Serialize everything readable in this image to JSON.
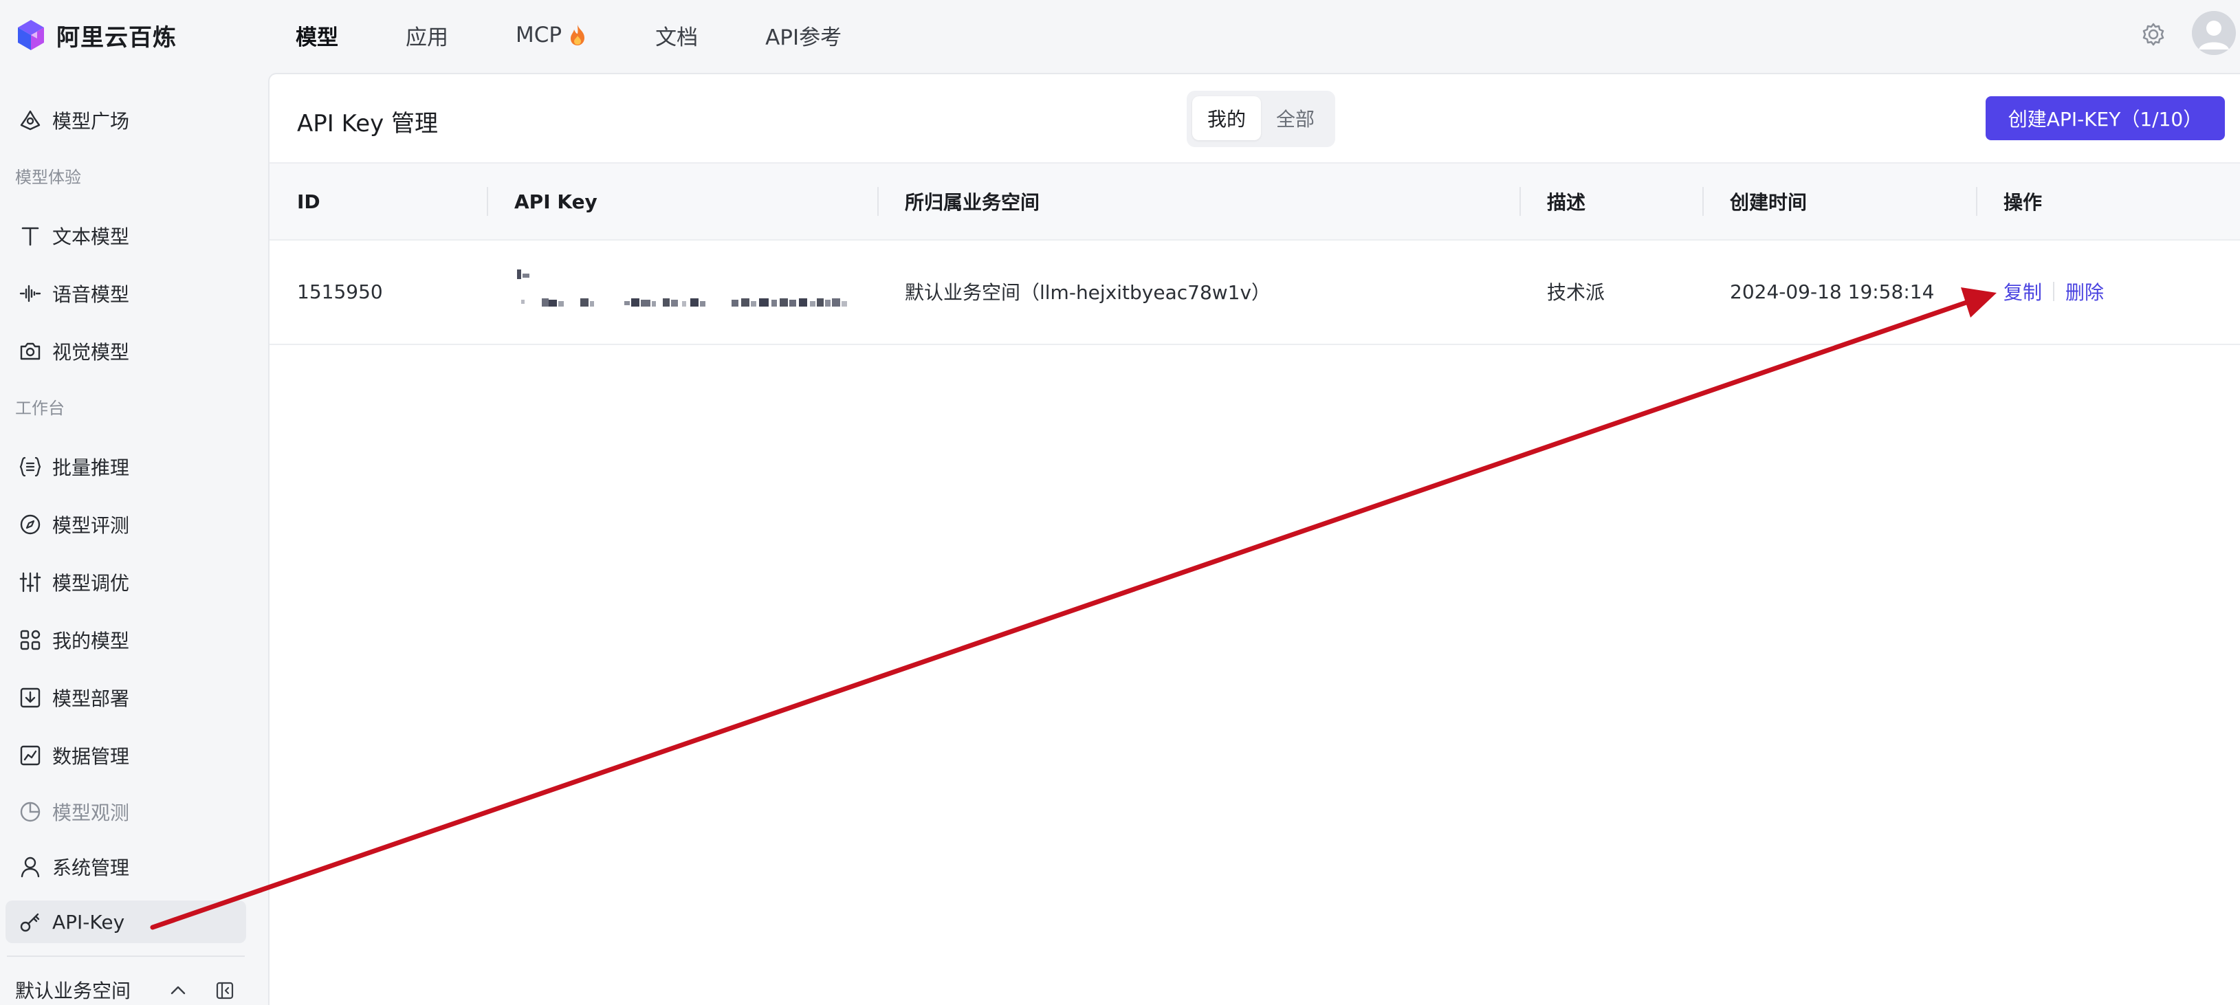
{
  "brand": {
    "name": "阿里云百炼"
  },
  "topnav": {
    "items": [
      {
        "label": "模型",
        "active": true
      },
      {
        "label": "应用",
        "active": false
      },
      {
        "label": "MCP",
        "active": false,
        "icon": "flame-icon"
      },
      {
        "label": "文档",
        "active": false
      },
      {
        "label": "API参考",
        "active": false
      }
    ],
    "settings_icon": "gear-icon",
    "avatar_icon": "user-avatar"
  },
  "sidebar": {
    "items": [
      {
        "label": "模型广场",
        "icon": "model-square-icon"
      },
      {
        "label": "文本模型",
        "icon": "text-icon"
      },
      {
        "label": "语音模型",
        "icon": "waveform-icon"
      },
      {
        "label": "视觉模型",
        "icon": "camera-icon"
      },
      {
        "label": "批量推理",
        "icon": "batch-icon"
      },
      {
        "label": "模型评测",
        "icon": "compass-icon"
      },
      {
        "label": "模型调优",
        "icon": "sliders-icon"
      },
      {
        "label": "我的模型",
        "icon": "grid-icon"
      },
      {
        "label": "模型部署",
        "icon": "deploy-icon"
      },
      {
        "label": "数据管理",
        "icon": "chart-icon"
      },
      {
        "label": "模型观测",
        "icon": "pie-icon",
        "muted": true
      },
      {
        "label": "系统管理",
        "icon": "user-icon"
      },
      {
        "label": "API-Key",
        "icon": "key-icon",
        "selected": true
      }
    ],
    "sections": {
      "experience": "模型体验",
      "workbench": "工作台"
    },
    "workspace": {
      "label": "默认业务空间"
    }
  },
  "main": {
    "title": "API Key 管理",
    "tabs": [
      {
        "label": "我的",
        "active": true
      },
      {
        "label": "全部",
        "active": false
      }
    ],
    "create_button": "创建API-KEY（1/10）",
    "table": {
      "headers": [
        "ID",
        "API Key",
        "所归属业务空间",
        "描述",
        "创建时间",
        "操作"
      ],
      "rows": [
        {
          "id": "1515950",
          "api_key": "",
          "workspace": "默认业务空间（llm-hejxitbyeac78w1v）",
          "description": "技术派",
          "created_at": "2024-09-18 19:58:14",
          "actions": [
            "复制",
            "删除"
          ]
        }
      ]
    }
  },
  "colors": {
    "accent": "#5143e8",
    "link": "#4a43e0",
    "annotation_arrow": "#c8101e"
  }
}
